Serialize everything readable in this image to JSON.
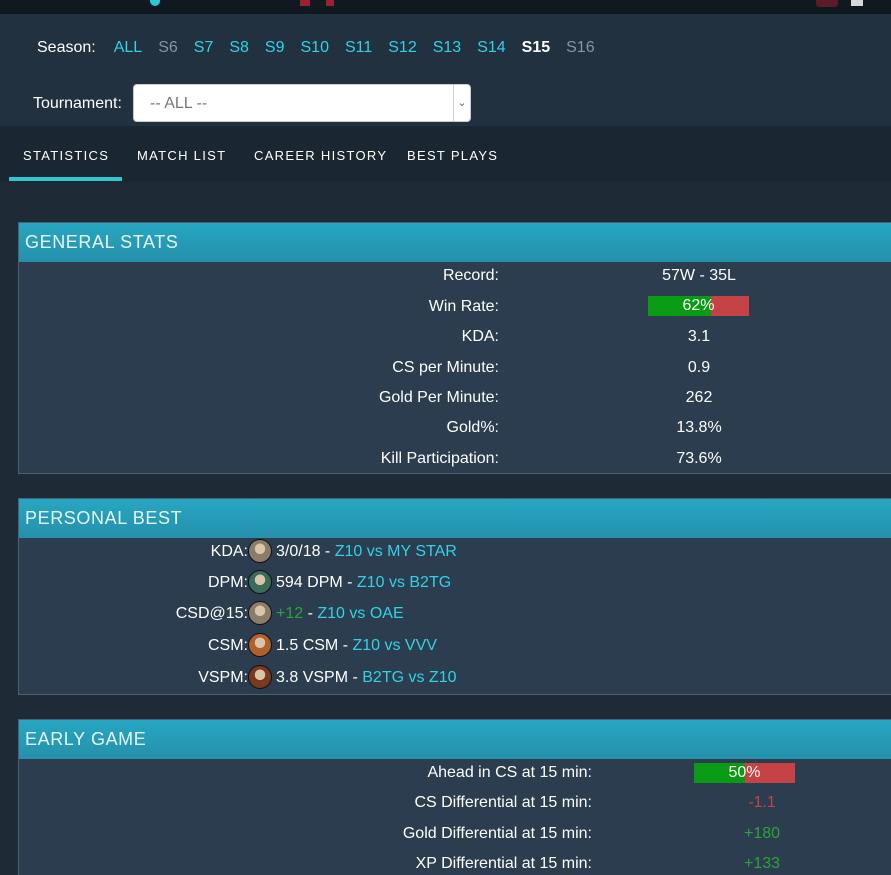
{
  "season": {
    "label": "Season:",
    "items": [
      {
        "label": "ALL",
        "state": "link"
      },
      {
        "label": "S6",
        "state": "dim"
      },
      {
        "label": "S7",
        "state": "link"
      },
      {
        "label": "S8",
        "state": "link"
      },
      {
        "label": "S9",
        "state": "link"
      },
      {
        "label": "S10",
        "state": "link"
      },
      {
        "label": "S11",
        "state": "link"
      },
      {
        "label": "S12",
        "state": "link"
      },
      {
        "label": "S13",
        "state": "link"
      },
      {
        "label": "S14",
        "state": "link"
      },
      {
        "label": "S15",
        "state": "active"
      },
      {
        "label": "S16",
        "state": "dim"
      }
    ]
  },
  "tournament": {
    "label": "Tournament:",
    "selected": "-- ALL --"
  },
  "tabs": [
    "STATISTICS",
    "MATCH LIST",
    "CAREER HISTORY",
    "BEST PLAYS"
  ],
  "active_tab": "STATISTICS",
  "general_stats": {
    "title": "GENERAL STATS",
    "record_label": "Record:",
    "record_value": "57W - 35L",
    "win_rate_label": "Win Rate:",
    "win_rate_value": "62%",
    "win_rate_fraction": 0.62,
    "kda_label": "KDA:",
    "kda_value": "3.1",
    "cs_label": "CS per Minute:",
    "cs_value": "0.9",
    "gpm_label": "Gold Per Minute:",
    "gpm_value": "262",
    "gold_pct_label": "Gold%:",
    "gold_pct_value": "13.8%",
    "kp_label": "Kill Participation:",
    "kp_value": "73.6%"
  },
  "personal_best": {
    "title": "PERSONAL BEST",
    "rows": [
      {
        "label": "KDA:",
        "avatar": "champion-portrait",
        "avatar_color": "#8a7b6a",
        "value": "3/0/18",
        "separator": " - ",
        "match": "Z10 vs MY STAR",
        "value_style": "plain"
      },
      {
        "label": "DPM:",
        "avatar": "champion-portrait",
        "avatar_color": "#3b6b5a",
        "value": "594 DPM",
        "separator": " - ",
        "match": "Z10 vs B2TG",
        "value_style": "plain"
      },
      {
        "label": "CSD@15:",
        "avatar": "champion-portrait",
        "avatar_color": "#8a7b6a",
        "value": "+12",
        "separator": " - ",
        "match": "Z10 vs OAE",
        "value_style": "pos"
      },
      {
        "label": "CSM:",
        "avatar": "champion-portrait",
        "avatar_color": "#b0602a",
        "value": "1.5 CSM",
        "separator": " - ",
        "match": "Z10 vs VVV",
        "value_style": "plain"
      },
      {
        "label": "VSPM:",
        "avatar": "champion-portrait",
        "avatar_color": "#7a3a20",
        "value": "3.8 VSPM",
        "separator": " - ",
        "match": "B2TG vs Z10",
        "value_style": "plain"
      }
    ]
  },
  "early_game": {
    "title": "EARLY GAME",
    "ahead_cs_label": "Ahead in CS at 15 min:",
    "ahead_cs_value": "50%",
    "ahead_cs_fraction": 0.5,
    "csd_label": "CS Differential at 15 min:",
    "csd_value": "-1.1",
    "gd_label": "Gold Differential at 15 min:",
    "gd_value": "+180",
    "xpd_label": "XP Differential at 15 min:",
    "xpd_value": "+133"
  },
  "colors": {
    "accent": "#2fd3e6",
    "header": "#27a7c2",
    "positive": "#2ca33a",
    "negative": "#c64345",
    "bar_green": "#0a9b14",
    "bar_red": "#c64345"
  }
}
